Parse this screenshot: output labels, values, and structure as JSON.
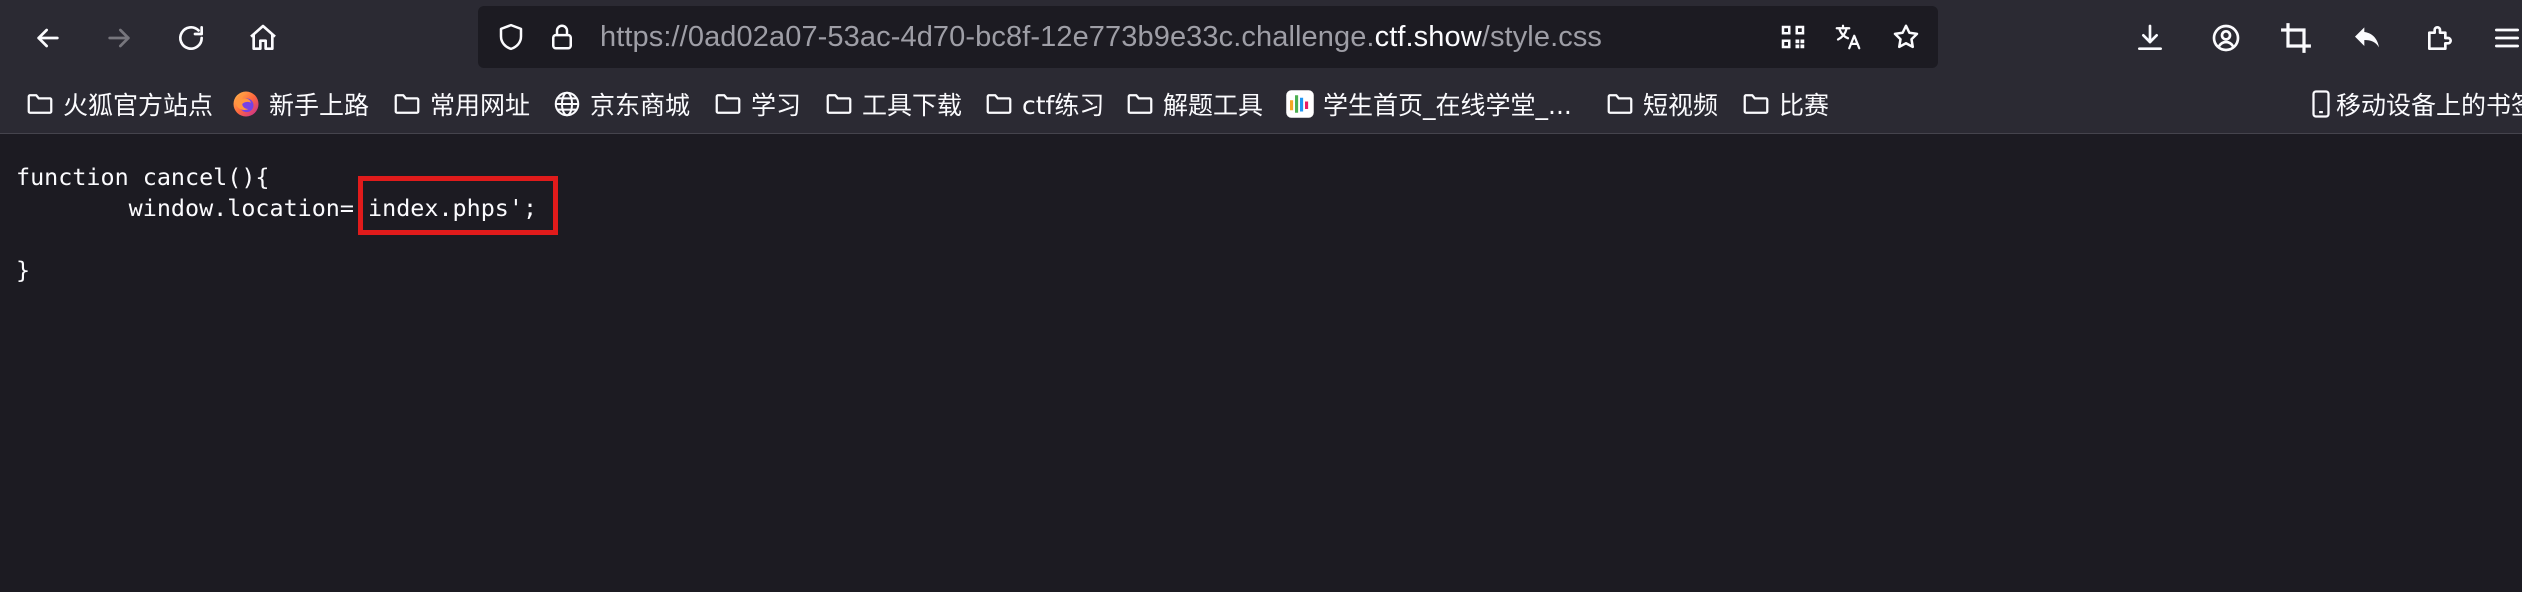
{
  "window": {
    "url_prefix": "https://0ad02a07-53ac-4d70-bc8f-12e773b9e33c.challenge.",
    "url_domain": "ctf.show",
    "url_path": "/style.css"
  },
  "toolbar": {
    "icons": [
      "back-icon",
      "forward-icon",
      "reload-icon",
      "home-icon",
      "shield-icon",
      "lock-icon",
      "qr-code-icon",
      "translate-icon",
      "star-icon",
      "download-icon",
      "account-icon",
      "crop-icon",
      "undo-icon",
      "extensions-icon",
      "menu-icon"
    ]
  },
  "bookmarks": {
    "items": [
      {
        "label": "火狐官方站点",
        "icon": "folder-icon"
      },
      {
        "label": "新手上路",
        "icon": "firefox-icon"
      },
      {
        "label": "常用网址",
        "icon": "folder-icon"
      },
      {
        "label": "京东商城",
        "icon": "globe-icon"
      },
      {
        "label": "学习",
        "icon": "folder-icon"
      },
      {
        "label": "工具下载",
        "icon": "folder-icon"
      },
      {
        "label": "ctf练习",
        "icon": "folder-icon"
      },
      {
        "label": "解题工具",
        "icon": "folder-icon"
      },
      {
        "label": "学生首页_在线学堂_...",
        "icon": "site-favicon-icon"
      },
      {
        "label": "短视频",
        "icon": "folder-icon"
      },
      {
        "label": "比赛",
        "icon": "folder-icon"
      },
      {
        "label": "移动设备上的书签",
        "icon": "mobile-icon"
      }
    ]
  },
  "content": {
    "code_lines": [
      "function cancel(){",
      "        window.location='index.phps';",
      "",
      "}"
    ]
  },
  "annotation": {
    "color": "#e01b1b",
    "highlighted_text": "'index.phps';"
  }
}
